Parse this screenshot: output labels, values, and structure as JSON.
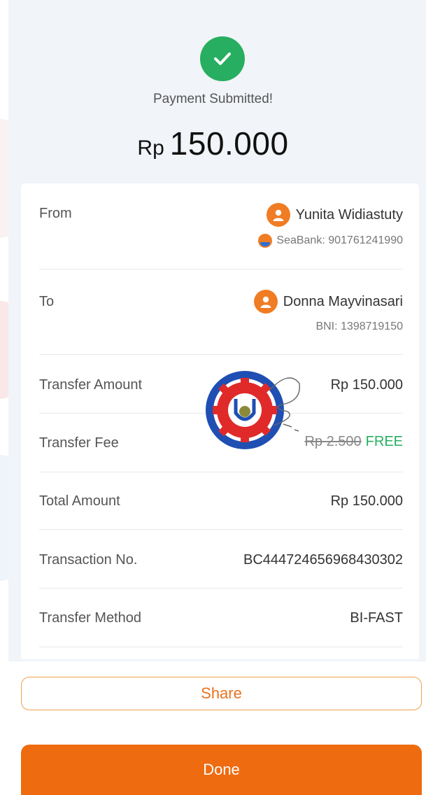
{
  "status": {
    "title": "Payment Submitted!",
    "currency": "Rp",
    "amount": "150.000"
  },
  "from": {
    "label": "From",
    "name": "Yunita Widiastuty",
    "bank": "SeaBank: 901761241990"
  },
  "to": {
    "label": "To",
    "name": "Donna Mayvinasari",
    "bank": "BNI: 1398719150"
  },
  "details": {
    "transfer_amount_label": "Transfer Amount",
    "transfer_amount_value": "Rp 150.000",
    "transfer_fee_label": "Transfer Fee",
    "transfer_fee_original": "Rp 2.500",
    "transfer_fee_free": "FREE",
    "total_amount_label": "Total Amount",
    "total_amount_value": "Rp 150.000",
    "transaction_no_label": "Transaction No.",
    "transaction_no_value": "BC444724656968430302",
    "transfer_method_label": "Transfer Method",
    "transfer_method_value": "BI-FAST"
  },
  "actions": {
    "share_label": "Share",
    "done_label": "Done"
  },
  "colors": {
    "success": "#27ae60",
    "accent": "#ee6b10",
    "avatar": "#f07c24"
  }
}
